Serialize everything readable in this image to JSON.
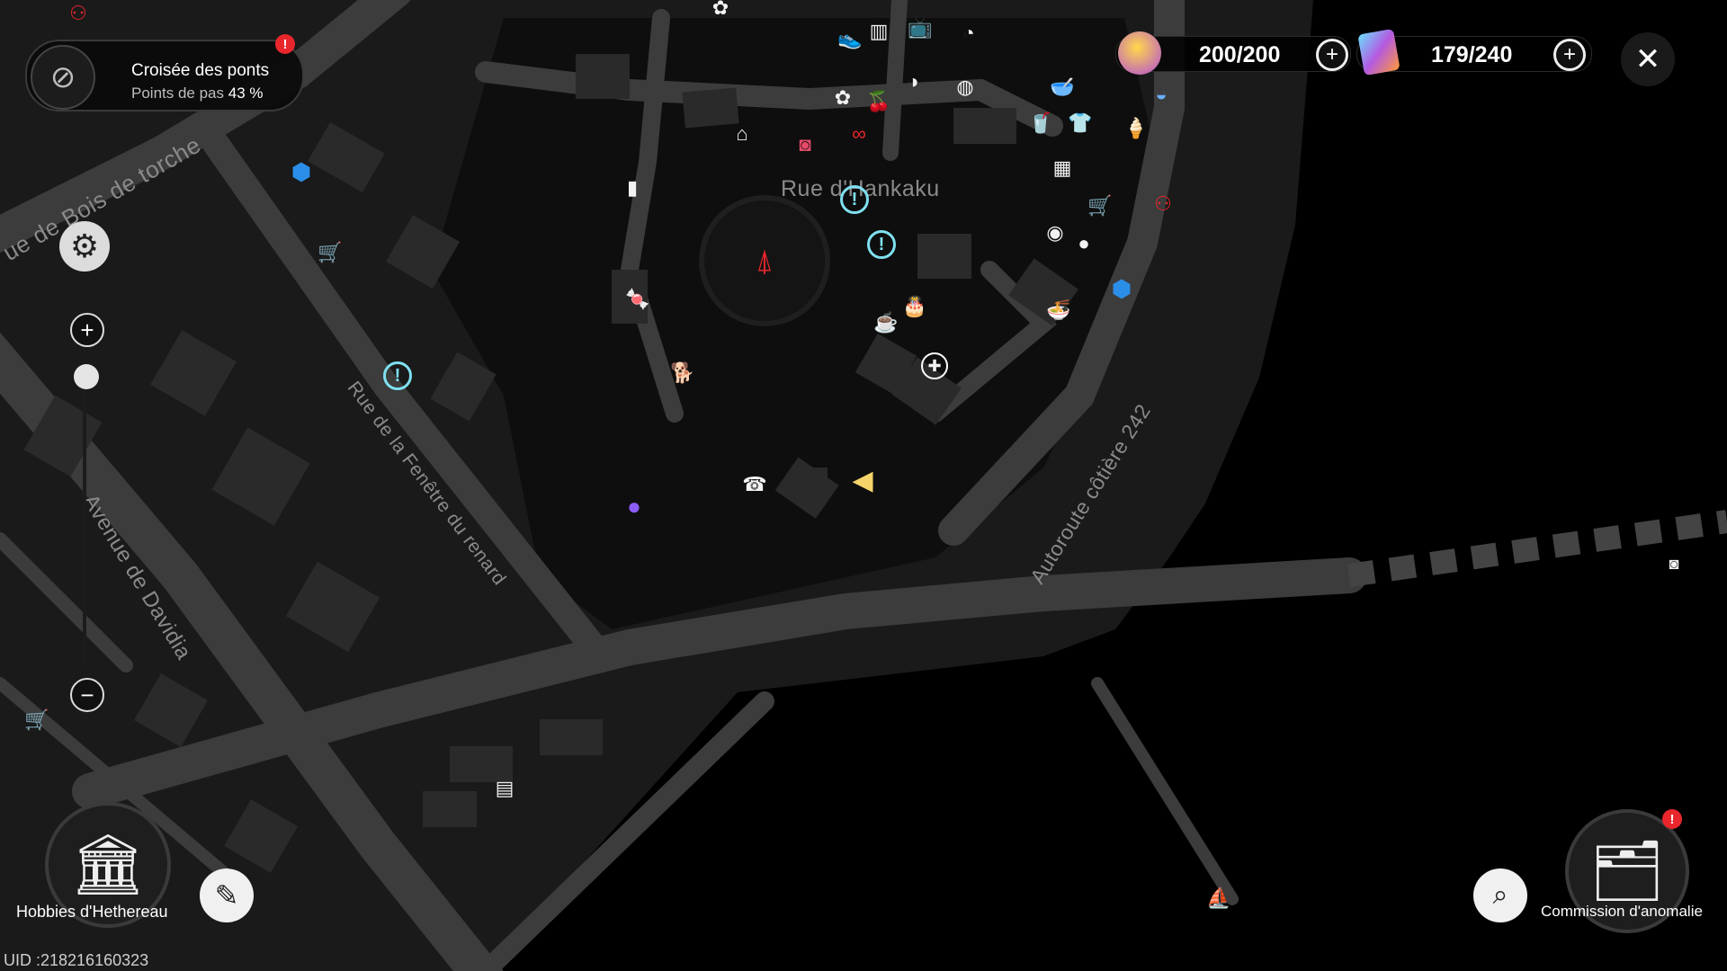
{
  "location_panel": {
    "title": "Croisée des ponts",
    "progress_label": "Points de pas",
    "progress_value": "43 %"
  },
  "resources": {
    "energy": {
      "value": "200/200",
      "icon": "energy-crystal-icon"
    },
    "film": {
      "value": "179/240",
      "icon": "film-roll-icon"
    }
  },
  "street_names": {
    "bois_de_torche": "ue de Bois de torche",
    "hankaku": "Rue d'Hankaku",
    "fenetre_renard": "Rue de la Fenêtre du renard",
    "davidia": "Avenue de Davidia",
    "autoroute": "Autoroute côtière 242"
  },
  "bottom_left": {
    "hobbies_label": "Hobbies d'Hethereau"
  },
  "bottom_right": {
    "commission_label": "Commission d'anomalie"
  },
  "uid": "UID :218216160323",
  "zoom": {
    "level": 0.1
  },
  "colors": {
    "road": "#3b3b3b",
    "building": "#262626",
    "block": "#1c1c1c",
    "water": "#000000",
    "alert_red": "#e8262c",
    "quest_cyan": "#7fe0f0",
    "map_blue": "#2b8ee8"
  },
  "pois": [
    {
      "name": "landmark-tower-icon",
      "glyph": "⛯"
    },
    {
      "name": "quest-marker-icon",
      "glyph": "!"
    },
    {
      "name": "shop-cart-icon",
      "glyph": "🛒"
    },
    {
      "name": "first-aid-icon",
      "glyph": "✚"
    },
    {
      "name": "player-arrow-icon",
      "glyph": "◀"
    }
  ]
}
